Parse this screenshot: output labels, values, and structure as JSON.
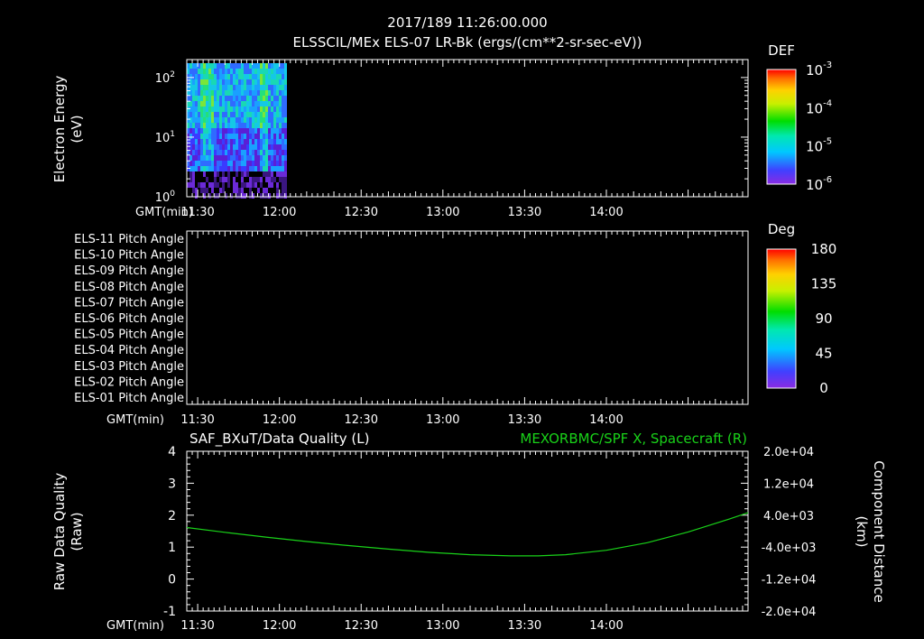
{
  "header": {
    "timestamp": "2017/189 11:26:00.000",
    "title": "ELSSCIL/MEx ELS-07 LR-Bk  (ergs/(cm**2-sr-sec-eV))"
  },
  "gmt_label": "GMT(min)",
  "time_ticks": [
    "11:30",
    "12:00",
    "12:30",
    "13:00",
    "13:30",
    "14:00"
  ],
  "colors": {
    "foreground": "#ffffff",
    "background": "#000000",
    "right_series": "#19d219"
  },
  "chart_data": [
    {
      "type": "heatmap",
      "ylabel_line1": "Electron Energy",
      "ylabel_line2": "(eV)",
      "yscale": "log",
      "ylim": [
        1,
        200
      ],
      "y_ticks": [
        {
          "base": "10",
          "exp": "0",
          "value": 1
        },
        {
          "base": "10",
          "exp": "1",
          "value": 10
        },
        {
          "base": "10",
          "exp": "2",
          "value": 100
        }
      ],
      "xlim": [
        "11:26",
        "14:52"
      ],
      "data_extent_x": [
        "11:26",
        "12:02"
      ],
      "colorbar": {
        "title": "DEF",
        "scale": "log",
        "range": [
          1e-06,
          0.001
        ],
        "ticks": [
          {
            "base": "10",
            "exp": "-3",
            "value": 0.001
          },
          {
            "base": "10",
            "exp": "-4",
            "value": 0.0001
          },
          {
            "base": "10",
            "exp": "-5",
            "value": 1e-05
          },
          {
            "base": "10",
            "exp": "-6",
            "value": 1e-06
          }
        ]
      }
    },
    {
      "type": "heatmap",
      "row_labels": [
        "ELS-11 Pitch Angle",
        "ELS-10 Pitch Angle",
        "ELS-09 Pitch Angle",
        "ELS-08 Pitch Angle",
        "ELS-07 Pitch Angle",
        "ELS-06 Pitch Angle",
        "ELS-05 Pitch Angle",
        "ELS-04 Pitch Angle",
        "ELS-03 Pitch Angle",
        "ELS-02 Pitch Angle",
        "ELS-01 Pitch Angle"
      ],
      "xlim": [
        "11:26",
        "14:52"
      ],
      "values": [],
      "colorbar": {
        "title": "Deg",
        "scale": "linear",
        "range": [
          0,
          180
        ],
        "ticks": [
          "180",
          "135",
          "90",
          "45",
          "0"
        ]
      }
    },
    {
      "type": "line",
      "left_title": "SAF_BXuT/Data Quality (L)",
      "right_title": "MEXORBMC/SPF X, Spacecraft (R)",
      "left_ylabel_line1": "Raw Data Quality",
      "left_ylabel_line2": "(Raw)",
      "right_ylabel_line1": "Component Distance",
      "right_ylabel_line2": "(km)",
      "left_ylim": [
        -1,
        4
      ],
      "left_ticks": [
        "4",
        "3",
        "2",
        "1",
        "0",
        "-1"
      ],
      "right_ylim": [
        -20000,
        20000
      ],
      "right_ticks": [
        "2.0e+04",
        "1.2e+04",
        "4.0e+03",
        "-4.0e+03",
        "-1.2e+04",
        "-2.0e+04"
      ],
      "xlim": [
        "11:26",
        "14:52"
      ],
      "series": [
        {
          "name": "MEXORBMC/SPF X, Spacecraft (R)",
          "axis": "right",
          "x": [
            "11:26",
            "11:40",
            "11:55",
            "12:10",
            "12:25",
            "12:40",
            "12:55",
            "13:10",
            "13:25",
            "13:35",
            "13:45",
            "14:00",
            "14:15",
            "14:30",
            "14:45",
            "14:52"
          ],
          "y": [
            900,
            -300,
            -1500,
            -2600,
            -3600,
            -4500,
            -5300,
            -5900,
            -6200,
            -6200,
            -5900,
            -4800,
            -2900,
            -200,
            3000,
            4600
          ]
        }
      ]
    }
  ]
}
